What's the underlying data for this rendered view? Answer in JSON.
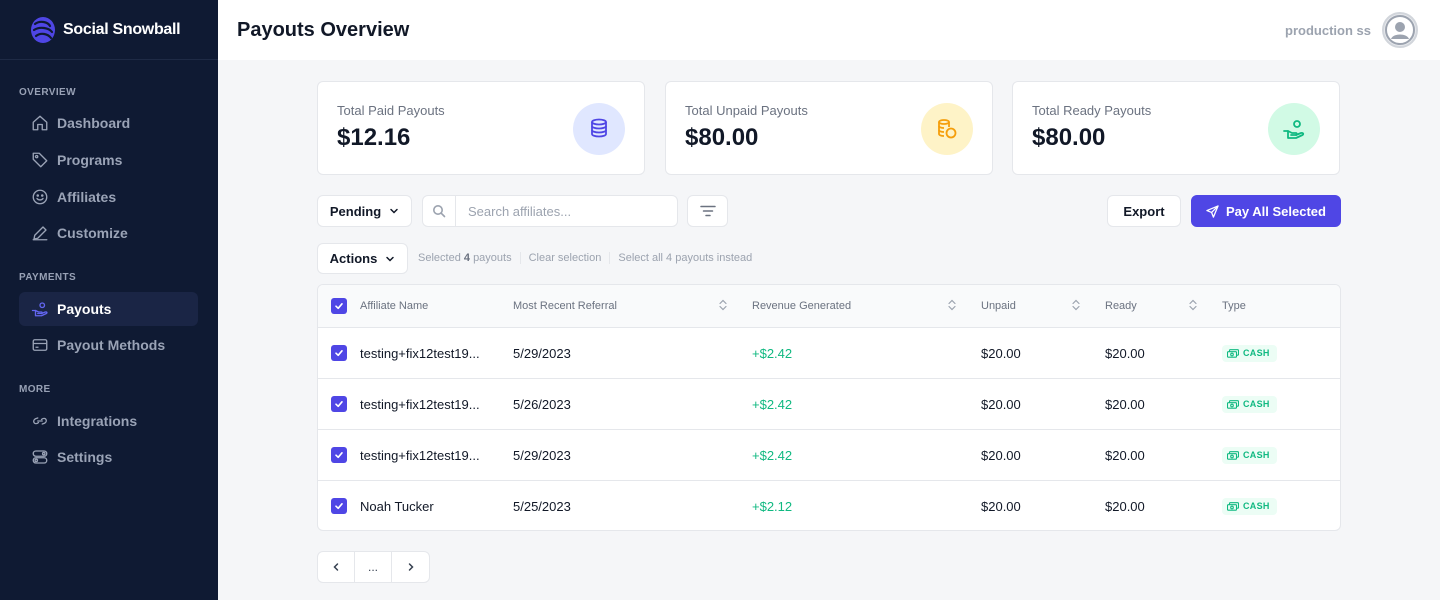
{
  "brand": {
    "name": "Social Snowball"
  },
  "sidebar": {
    "sections": [
      {
        "title": "OVERVIEW",
        "items": [
          {
            "label": "Dashboard",
            "icon": "home-icon"
          },
          {
            "label": "Programs",
            "icon": "tag-icon"
          },
          {
            "label": "Affiliates",
            "icon": "smile-icon"
          },
          {
            "label": "Customize",
            "icon": "pen-icon"
          }
        ]
      },
      {
        "title": "PAYMENTS",
        "items": [
          {
            "label": "Payouts",
            "icon": "hand-coins-icon",
            "active": true
          },
          {
            "label": "Payout Methods",
            "icon": "credit-card-icon"
          }
        ]
      },
      {
        "title": "MORE",
        "items": [
          {
            "label": "Integrations",
            "icon": "link-icon"
          },
          {
            "label": "Settings",
            "icon": "toggle-icon"
          }
        ]
      }
    ]
  },
  "header": {
    "title": "Payouts Overview",
    "user_name": "production ss"
  },
  "stats": [
    {
      "label": "Total Paid Payouts",
      "value": "$12.16",
      "icon": "coins-stack-icon",
      "color": "#4f46e5"
    },
    {
      "label": "Total Unpaid Payouts",
      "value": "$80.00",
      "icon": "coins-icon",
      "color": "#f59e0b"
    },
    {
      "label": "Total Ready Payouts",
      "value": "$80.00",
      "icon": "hand-coins-icon",
      "color": "#10b981"
    }
  ],
  "filters": {
    "status_value": "Pending",
    "search_placeholder": "Search affiliates...",
    "export_label": "Export",
    "pay_all_label": "Pay All Selected",
    "actions_label": "Actions"
  },
  "selection": {
    "selected_prefix": "Selected",
    "selected_count": "4",
    "selected_suffix": "payouts",
    "clear_label": "Clear selection",
    "select_all_label": "Select all 4 payouts instead"
  },
  "table": {
    "columns": [
      "Affiliate Name",
      "Most Recent Referral",
      "Revenue Generated",
      "Unpaid",
      "Ready",
      "Type"
    ],
    "rows": [
      {
        "name": "testing+fix12test19...",
        "referral": "5/29/2023",
        "revenue": "+$2.42",
        "unpaid": "$20.00",
        "ready": "$20.00",
        "type": "CASH"
      },
      {
        "name": "testing+fix12test19...",
        "referral": "5/26/2023",
        "revenue": "+$2.42",
        "unpaid": "$20.00",
        "ready": "$20.00",
        "type": "CASH"
      },
      {
        "name": "testing+fix12test19...",
        "referral": "5/29/2023",
        "revenue": "+$2.42",
        "unpaid": "$20.00",
        "ready": "$20.00",
        "type": "CASH"
      },
      {
        "name": "Noah Tucker",
        "referral": "5/25/2023",
        "revenue": "+$2.12",
        "unpaid": "$20.00",
        "ready": "$20.00",
        "type": "CASH"
      }
    ]
  },
  "pagination": {
    "ellipsis": "..."
  }
}
